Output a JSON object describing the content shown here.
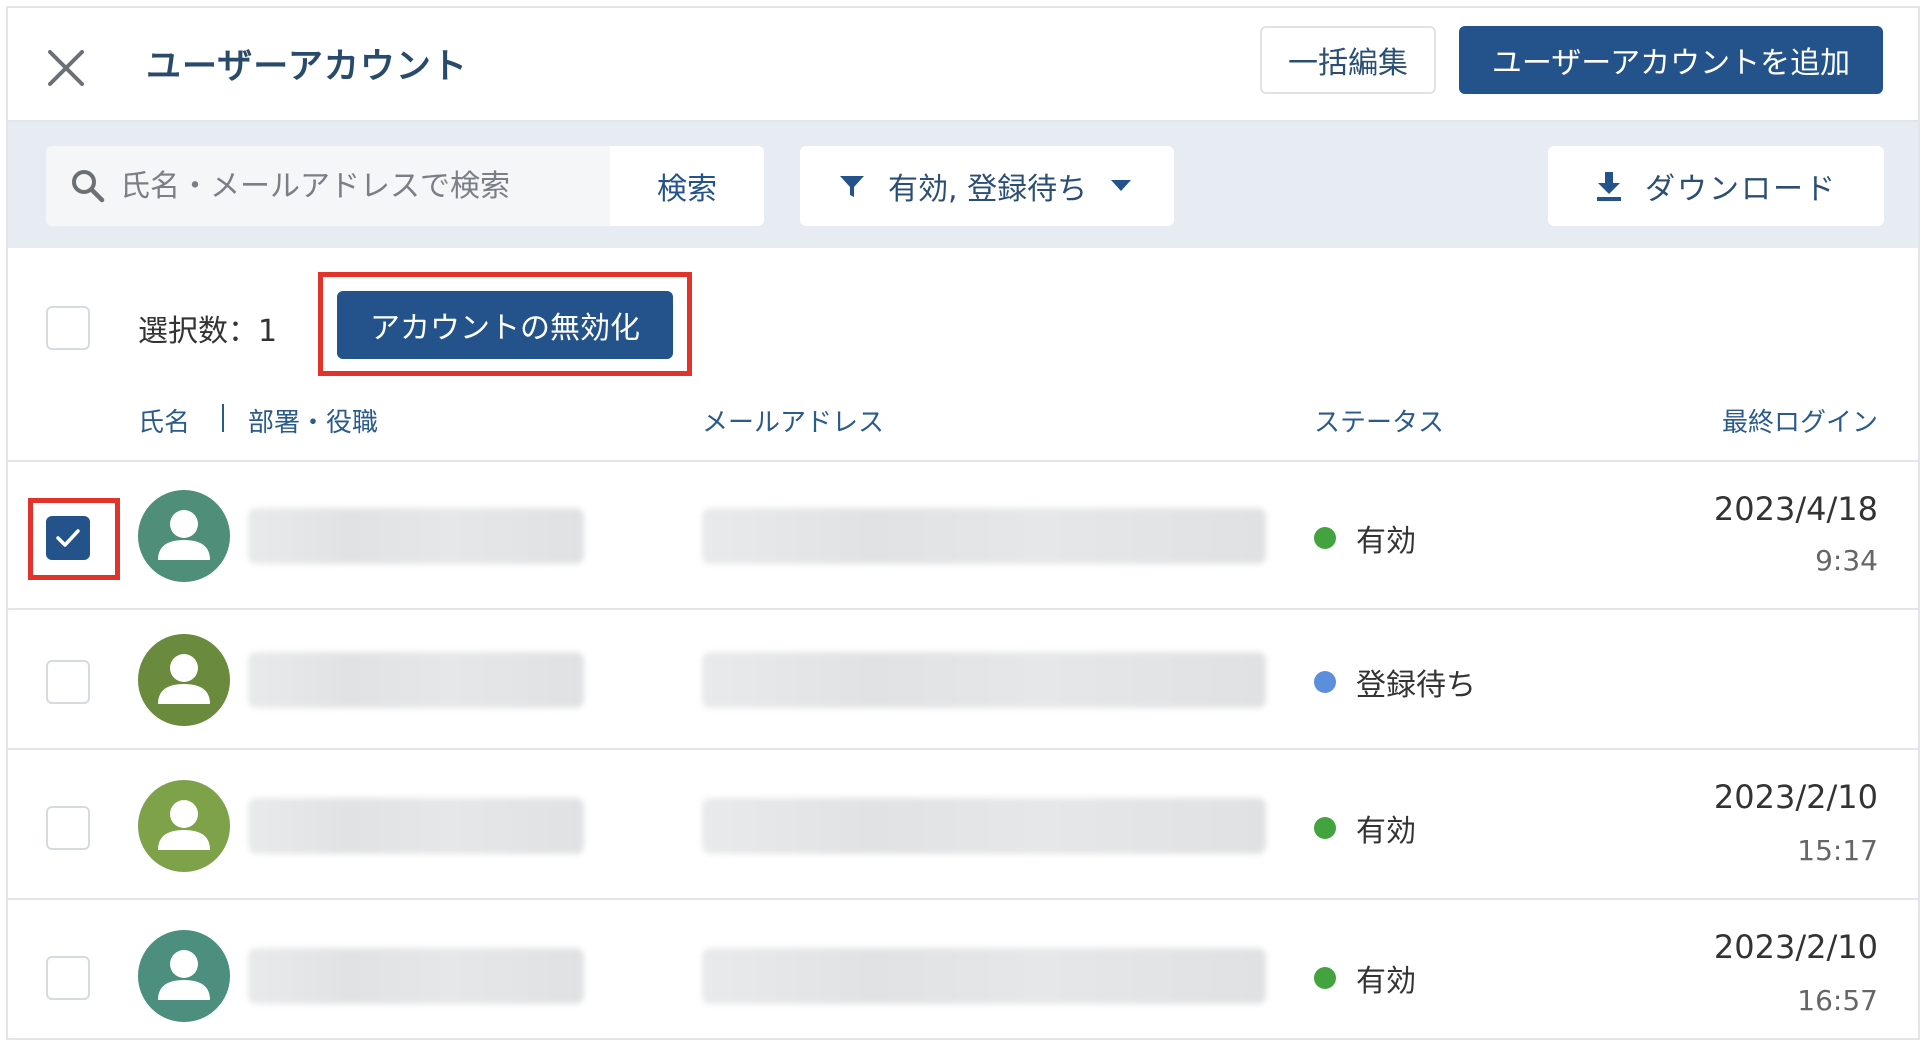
{
  "header": {
    "title": "ユーザーアカウント",
    "bulk_edit_label": "一括編集",
    "add_account_label": "ユーザーアカウントを追加"
  },
  "toolbar": {
    "search_placeholder": "氏名・メールアドレスで検索",
    "search_button_label": "検索",
    "filter_label": "有効, 登録待ち",
    "download_label": "ダウンロード"
  },
  "selection": {
    "count_label": "選択数：1",
    "deactivate_label": "アカウントの無効化"
  },
  "columns": {
    "name": "氏名",
    "dept": "部署・役職",
    "email": "メールアドレス",
    "status": "ステータス",
    "last_login": "最終ログイン"
  },
  "rows": [
    {
      "checked": true,
      "status": "有効",
      "status_color": "#43a33e",
      "login_date": "2023/4/18",
      "login_time": "9:34",
      "avatar_color": "#4f8e78"
    },
    {
      "checked": false,
      "status": "登録待ち",
      "status_color": "#5b8fdc",
      "login_date": "",
      "login_time": "",
      "avatar_color": "#6a8a3e"
    },
    {
      "checked": false,
      "status": "有効",
      "status_color": "#43a33e",
      "login_date": "2023/2/10",
      "login_time": "15:17",
      "avatar_color": "#7ea24a"
    },
    {
      "checked": false,
      "status": "有効",
      "status_color": "#43a33e",
      "login_date": "2023/2/10",
      "login_time": "16:57",
      "avatar_color": "#4c8f7f"
    }
  ],
  "colors": {
    "primary": "#23538a",
    "highlight": "#e2332b"
  }
}
